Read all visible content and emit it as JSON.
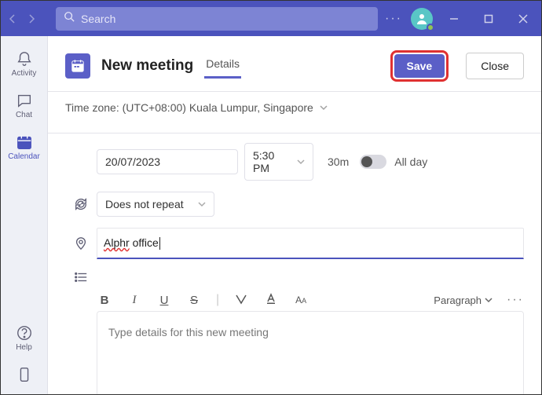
{
  "titlebar": {
    "search_placeholder": "Search",
    "ellipsis": "···"
  },
  "rail": {
    "activity": "Activity",
    "chat": "Chat",
    "calendar": "Calendar",
    "help": "Help"
  },
  "header": {
    "title": "New meeting",
    "tab_details": "Details",
    "save_label": "Save",
    "close_label": "Close"
  },
  "timezone": {
    "label": "Time zone: (UTC+08:00) Kuala Lumpur, Singapore"
  },
  "form": {
    "date_value": "20/07/2023",
    "time_value": "5:30 PM",
    "duration": "30m",
    "all_day_label": "All day",
    "repeat_value": "Does not repeat",
    "location_value_word1": "Alphr",
    "location_value_word2": "office"
  },
  "editor": {
    "paragraph_label": "Paragraph",
    "placeholder": "Type details for this new meeting",
    "toolbar_more": "···"
  }
}
